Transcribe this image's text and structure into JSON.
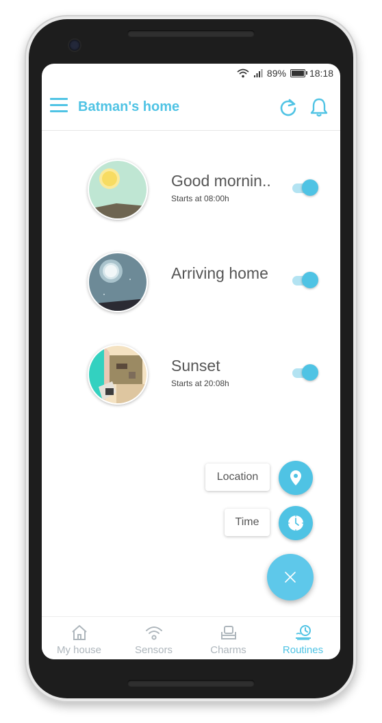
{
  "status_bar": {
    "battery": "89%",
    "time": "18:18"
  },
  "app_bar": {
    "title": "Batman's home"
  },
  "routines": [
    {
      "name": "Good mornin..",
      "subtitle": "Starts at 08:00h",
      "enabled": true,
      "thumbnail": "sunny-morning-illustration"
    },
    {
      "name": "Arriving home",
      "subtitle": "",
      "enabled": true,
      "thumbnail": "night-moon-illustration"
    },
    {
      "name": "Sunset",
      "subtitle": "Starts at 20:08h",
      "enabled": true,
      "thumbnail": "living-room-sunset-illustration"
    }
  ],
  "fab_menu": {
    "location_label": "Location",
    "time_label": "Time"
  },
  "bottom_nav": [
    {
      "label": "My house",
      "icon": "house-icon",
      "active": false
    },
    {
      "label": "Sensors",
      "icon": "wifi-icon",
      "active": false
    },
    {
      "label": "Charms",
      "icon": "sofa-icon",
      "active": false
    },
    {
      "label": "Routines",
      "icon": "routine-clock-icon",
      "active": true
    }
  ],
  "colors": {
    "accent": "#4fc3e4",
    "inactive_nav": "#aeb6bc",
    "text": "#555555"
  }
}
